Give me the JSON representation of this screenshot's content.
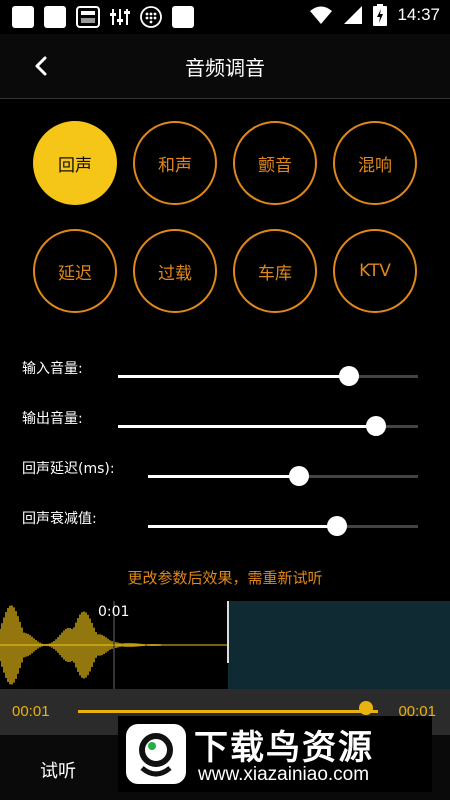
{
  "status_bar": {
    "time": "14:37"
  },
  "header": {
    "title": "音频调音"
  },
  "effects": [
    {
      "label": "回声",
      "active": true
    },
    {
      "label": "和声",
      "active": false
    },
    {
      "label": "颤音",
      "active": false
    },
    {
      "label": "混响",
      "active": false
    },
    {
      "label": "延迟",
      "active": false
    },
    {
      "label": "过载",
      "active": false
    },
    {
      "label": "车库",
      "active": false
    },
    {
      "label": "KTV",
      "active": false
    }
  ],
  "sliders": [
    {
      "label": "输入音量:",
      "value": 0.77
    },
    {
      "label": "输出音量:",
      "value": 0.86
    },
    {
      "label": "回声延迟(ms):",
      "value": 0.56
    },
    {
      "label": "回声衰减值:",
      "value": 0.7
    }
  ],
  "hint": "更改参数后效果，需重新试听",
  "waveform": {
    "marker_time": "0:01"
  },
  "player": {
    "current_time": "00:01",
    "total_time": "00:01",
    "progress": 0.96
  },
  "bottom": {
    "listen_label": "试听"
  },
  "watermark": {
    "title": "下载鸟资源",
    "url": "www.xiazainiao.com"
  },
  "colors": {
    "accent": "#e0871c",
    "active": "#f5c518",
    "player": "#e8b30f"
  }
}
